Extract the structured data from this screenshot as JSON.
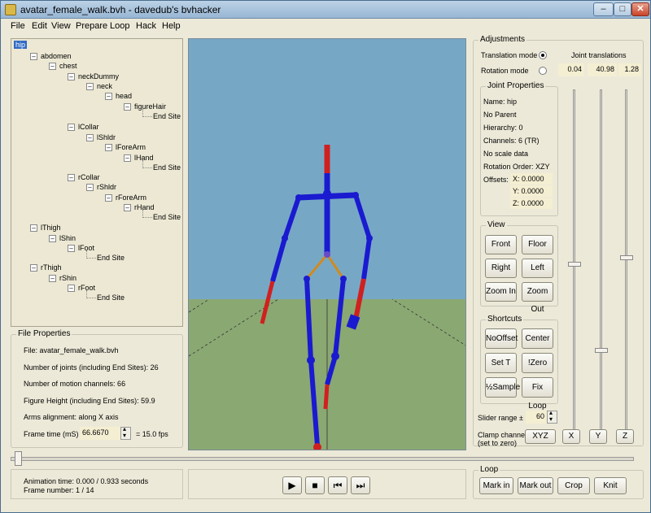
{
  "window": {
    "title": "avatar_female_walk.bvh - davedub's bvhacker",
    "minimize_icon": "minimize-icon",
    "maximize_icon": "maximize-icon",
    "close_icon": "close-icon"
  },
  "menu": [
    "File",
    "Edit",
    "View",
    "Prepare",
    "Loop",
    "Hack",
    "Help"
  ],
  "tree": [
    {
      "label": "hip",
      "selected": true
    },
    {
      "label": "abdomen"
    },
    {
      "label": "chest"
    },
    {
      "label": "neckDummy"
    },
    {
      "label": "neck"
    },
    {
      "label": "head"
    },
    {
      "label": "figureHair"
    },
    {
      "label": "End Site"
    },
    {
      "label": "lCollar"
    },
    {
      "label": "lShldr"
    },
    {
      "label": "lForeArm"
    },
    {
      "label": "lHand"
    },
    {
      "label": "End Site"
    },
    {
      "label": "rCollar"
    },
    {
      "label": "rShldr"
    },
    {
      "label": "rForeArm"
    },
    {
      "label": "rHand"
    },
    {
      "label": "End Site"
    },
    {
      "label": "lThigh"
    },
    {
      "label": "lShin"
    },
    {
      "label": "lFoot"
    },
    {
      "label": "End Site"
    },
    {
      "label": "rThigh"
    },
    {
      "label": "rShin"
    },
    {
      "label": "rFoot"
    },
    {
      "label": "End Site"
    }
  ],
  "file_properties": {
    "title": "File Properties",
    "file": "File: avatar_female_walk.bvh",
    "joints": "Number of joints (including End Sites): 26",
    "channels": "Number of motion channels: 66",
    "height": "Figure Height (including End Sites): 59.9",
    "arms": "Arms alignment: along X axis",
    "frame_time_label": "Frame time (mS)",
    "frame_time_value": "66.6670",
    "fps": "= 15.0 fps"
  },
  "adjustments": {
    "title": "Adjustments",
    "translation_mode": "Translation mode",
    "rotation_mode": "Rotation mode",
    "mode_selected": "translation",
    "joint_translations_label": "Joint translations",
    "tx": "0.04",
    "ty": "40.98",
    "tz": "1.28"
  },
  "joint_properties": {
    "title": "Joint Properties",
    "name": "Name: hip",
    "parent": "No Parent",
    "hierarchy": "Hierarchy: 0",
    "channels": "Channels: 6 (TR)",
    "scale": "No scale data",
    "rotation_order": "Rotation Order: XZY",
    "offsets_label": "Offsets:",
    "offset_x": "X:  0.0000",
    "offset_y": "Y:  0.0000",
    "offset_z": "Z:  0.0000"
  },
  "view": {
    "title": "View",
    "front": "Front",
    "floor": "Floor",
    "right": "Right",
    "left": "Left",
    "zoom_in": "Zoom In",
    "zoom_out": "Zoom Out"
  },
  "shortcuts": {
    "title": "Shortcuts",
    "no_offset": "NoOffset",
    "center": "Center",
    "set_t": "Set T",
    "zero": "!Zero",
    "half_sample": "½Sample",
    "fix_loop": "Fix Loop"
  },
  "slider_range": {
    "label": "Slider range ±",
    "value": "60"
  },
  "clamp": {
    "label1": "Clamp channel",
    "label2": "(set to zero)",
    "xyz": "XYZ",
    "x": "X",
    "y": "Y",
    "z": "Z"
  },
  "status": {
    "animation_time": "Animation time: 0.000 / 0.933 seconds",
    "frame_number": "Frame number: 1 / 14"
  },
  "transport": [
    "play-icon",
    "stop-icon",
    "skip-back-icon",
    "skip-forward-icon"
  ],
  "loop": {
    "title": "Loop",
    "mark_in": "Mark in",
    "mark_out": "Mark out",
    "crop": "Crop",
    "knit": "Knit"
  },
  "sliders": {
    "translation_x_level": 0.5,
    "translation_y_level": 0.25,
    "translation_z_level": 0.52
  }
}
